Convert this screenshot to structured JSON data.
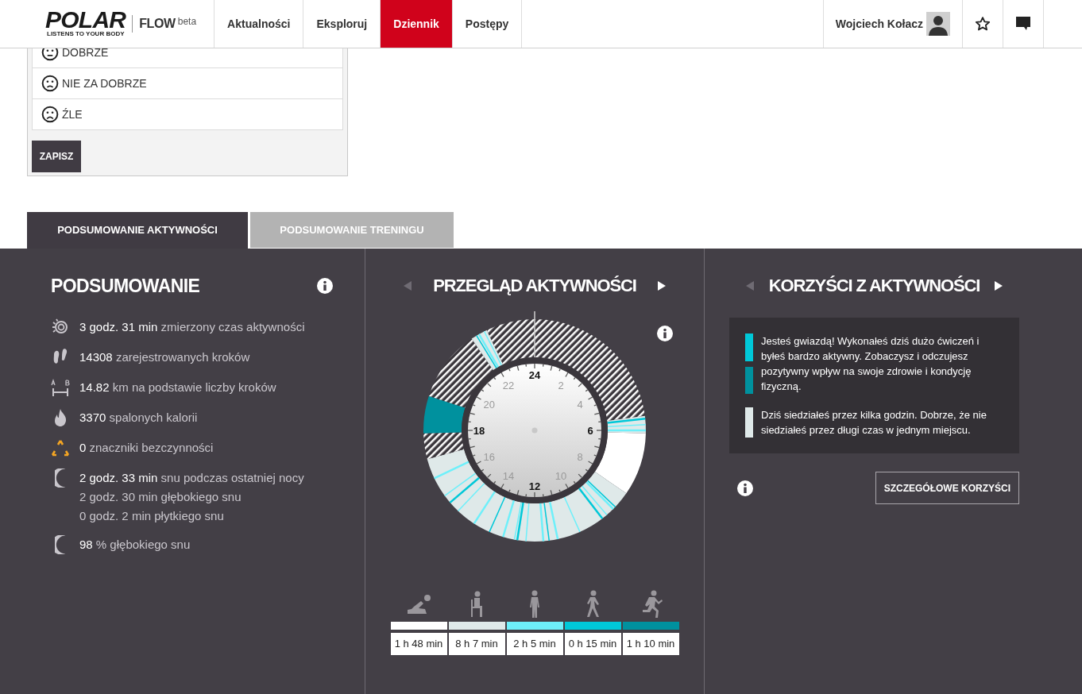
{
  "header": {
    "logo": "POLAR",
    "tagline": "LISTENS TO YOUR BODY",
    "product": "FLOW",
    "product_tag": "beta",
    "nav": [
      {
        "label": "Aktualności",
        "selected": false
      },
      {
        "label": "Eksploruj",
        "selected": false
      },
      {
        "label": "Dziennik",
        "selected": true
      },
      {
        "label": "Postępy",
        "selected": false
      }
    ],
    "user": "Wojciech Kołacz"
  },
  "mood_options": [
    {
      "kind": "neutral",
      "label": "DOBRZE"
    },
    {
      "kind": "sad",
      "label": "NIE ZA DOBRZE"
    },
    {
      "kind": "bad",
      "label": "ŹLE"
    }
  ],
  "save_button": "ZAPISZ",
  "tabs": [
    {
      "label": "PODSUMOWANIE AKTYWNOŚCI",
      "selected": true
    },
    {
      "label": "PODSUMOWANIE TRENINGU",
      "selected": false
    }
  ],
  "summary": {
    "title": "PODSUMOWANIE",
    "items": [
      {
        "kind": "active_time",
        "value": "3 godz. 31 min",
        "label": "zmierzony czas aktywności"
      },
      {
        "kind": "steps",
        "value": "14308",
        "label": "zarejestrowanych kroków"
      },
      {
        "kind": "distance",
        "value": "14.82",
        "label": "km na podstawie liczby kroków"
      },
      {
        "kind": "calories",
        "value": "3370",
        "label": "spalonych kalorii"
      },
      {
        "kind": "inactivity",
        "value": "0",
        "label": "znaczniki bezczynności"
      },
      {
        "kind": "sleep",
        "value": "2 godz. 33 min",
        "label": "snu podczas ostatniej nocy",
        "details": [
          "2 godz. 30 min głębokiego snu",
          "0 godz. 2 min płytkiego snu"
        ]
      },
      {
        "kind": "sleep",
        "value": "98",
        "label": "% głębokiego snu"
      }
    ]
  },
  "overview": {
    "title": "PRZEGLĄD AKTYWNOŚCI",
    "prev_enabled": false,
    "next_enabled": true,
    "hour_labels": [
      {
        "label": "24",
        "major": true
      },
      {
        "label": "2",
        "major": false
      },
      {
        "label": "4",
        "major": false
      },
      {
        "label": "6",
        "major": true
      },
      {
        "label": "8",
        "major": false
      },
      {
        "label": "10",
        "major": false
      },
      {
        "label": "12",
        "major": true
      },
      {
        "label": "14",
        "major": false
      },
      {
        "label": "16",
        "major": false
      },
      {
        "label": "18",
        "major": true
      },
      {
        "label": "20",
        "major": false
      },
      {
        "label": "22",
        "major": false
      }
    ],
    "legend": [
      {
        "kind": "lying",
        "color": "#ffffff",
        "duration": "1 h 48 min"
      },
      {
        "kind": "sitting",
        "color": "#dfe9e9",
        "duration": "8 h 7 min"
      },
      {
        "kind": "standing",
        "color": "#6ef0fa",
        "duration": "2 h 5 min"
      },
      {
        "kind": "walking",
        "color": "#00c8d8",
        "duration": "0 h 15 min"
      },
      {
        "kind": "running",
        "color": "#00919e",
        "duration": "1 h 10 min"
      }
    ]
  },
  "benefits": {
    "title": "KORZYŚCI Z AKTYWNOŚCI",
    "prev_enabled": false,
    "next_enabled": true,
    "messages": [
      {
        "bars": [
          {
            "color": "#00c8d8"
          },
          {
            "color": "#00919e"
          }
        ],
        "text": "Jesteś gwiazdą! Wykonałeś dziś dużo ćwiczeń i byłeś bardzo aktywny. Zobaczysz i odczujesz pozytywny wpływ na swoje zdrowie i kondycję fizyczną."
      },
      {
        "bars": [
          {
            "color": "#dfe9e9"
          }
        ],
        "text": "Dziś siedziałeś przez kilka godzin. Dobrze, że nie siedziałeś przez długi czas w jednym miejscu."
      }
    ],
    "details_button": "SZCZEGÓŁOWE KORZYŚCI"
  }
}
